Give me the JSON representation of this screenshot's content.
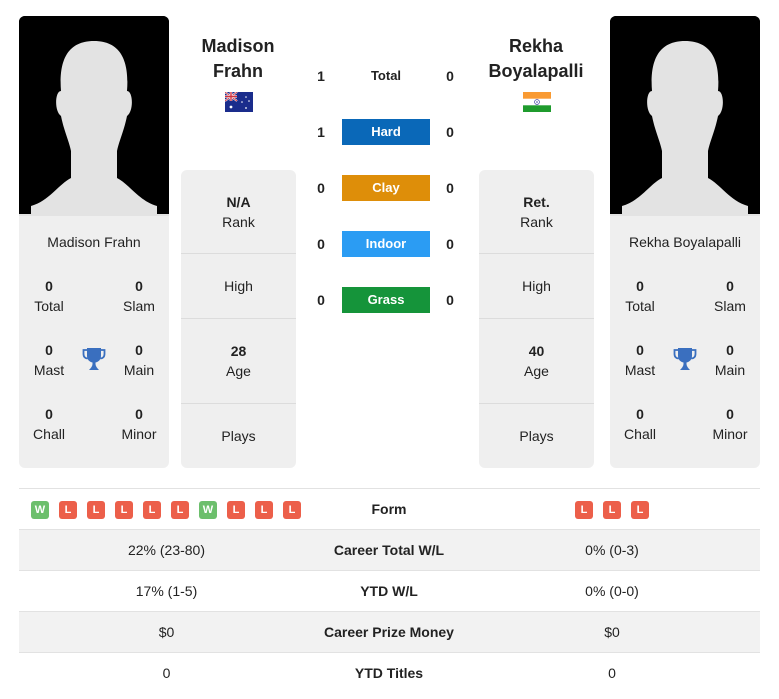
{
  "player1": {
    "name_line1": "Madison",
    "name_line2": "Frahn",
    "full_name": "Madison Frahn",
    "country": "Australia",
    "flag_icon": "australia-flag-icon",
    "titles": {
      "total": {
        "value": "0",
        "label": "Total"
      },
      "slam": {
        "value": "0",
        "label": "Slam"
      },
      "mast": {
        "value": "0",
        "label": "Mast"
      },
      "main": {
        "value": "0",
        "label": "Main"
      },
      "chall": {
        "value": "0",
        "label": "Chall"
      },
      "minor": {
        "value": "0",
        "label": "Minor"
      }
    },
    "info": {
      "rank_value": "N/A",
      "rank_label": "Rank",
      "high_label": "High",
      "age_value": "28",
      "age_label": "Age",
      "plays_label": "Plays"
    },
    "form": [
      "W",
      "L",
      "L",
      "L",
      "L",
      "L",
      "W",
      "L",
      "L",
      "L"
    ]
  },
  "player2": {
    "name_line1": "Rekha",
    "name_line2": "Boyalapalli",
    "full_name": "Rekha Boyalapalli",
    "country": "India",
    "flag_icon": "india-flag-icon",
    "titles": {
      "total": {
        "value": "0",
        "label": "Total"
      },
      "slam": {
        "value": "0",
        "label": "Slam"
      },
      "mast": {
        "value": "0",
        "label": "Mast"
      },
      "main": {
        "value": "0",
        "label": "Main"
      },
      "chall": {
        "value": "0",
        "label": "Chall"
      },
      "minor": {
        "value": "0",
        "label": "Minor"
      }
    },
    "info": {
      "rank_value": "Ret.",
      "rank_label": "Rank",
      "high_label": "High",
      "age_value": "40",
      "age_label": "Age",
      "plays_label": "Plays"
    },
    "form": [
      "L",
      "L",
      "L"
    ]
  },
  "h2h": [
    {
      "surface": "Total",
      "p1": "1",
      "p2": "0",
      "color": ""
    },
    {
      "surface": "Hard",
      "p1": "1",
      "p2": "0",
      "color": "#0a68b8"
    },
    {
      "surface": "Clay",
      "p1": "0",
      "p2": "0",
      "color": "#de8e09"
    },
    {
      "surface": "Indoor",
      "p1": "0",
      "p2": "0",
      "color": "#2b9cf3"
    },
    {
      "surface": "Grass",
      "p1": "0",
      "p2": "0",
      "color": "#15943a"
    }
  ],
  "comparison": {
    "form_label": "Form",
    "rows": [
      {
        "label": "Career Total W/L",
        "p1": "22% (23-80)",
        "p2": "0% (0-3)"
      },
      {
        "label": "YTD W/L",
        "p1": "17% (1-5)",
        "p2": "0% (0-0)"
      },
      {
        "label": "Career Prize Money",
        "p1": "$0",
        "p2": "$0"
      },
      {
        "label": "YTD Titles",
        "p1": "0",
        "p2": "0"
      }
    ]
  },
  "colors": {
    "win": "#6cbf6c",
    "loss": "#ec5f4a",
    "card_bg": "#efefef",
    "trophy": "#3a6fbf"
  }
}
